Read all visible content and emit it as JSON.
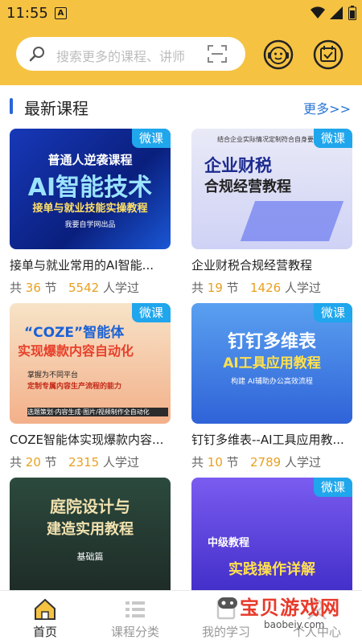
{
  "status": {
    "time": "11:55",
    "notif": "A"
  },
  "search": {
    "placeholder": "搜索更多的课程、讲师"
  },
  "section": {
    "title": "最新课程",
    "more": "更多>>"
  },
  "courses": [
    {
      "tag": "微课",
      "title": "接单与就业常用的AI智能...",
      "count_pre": "共",
      "lessons": "36",
      "count_suf": "节",
      "learners": "5542",
      "learn_suf": "人学过",
      "art": {
        "l1": "普通人逆袭课程",
        "l2": "AI智能技术",
        "l3": "接单与就业技能实操教程",
        "l4": "我要自学网出品"
      }
    },
    {
      "tag": "微课",
      "title": "企业财税合规经营教程",
      "count_pre": "共",
      "lessons": "19",
      "count_suf": "节",
      "learners": "1426",
      "learn_suf": "人学过",
      "art": {
        "l0": "结合企业实际情况定制符合自身要求和",
        "l1": "企业财税",
        "l2": "合规经营教程"
      }
    },
    {
      "tag": "微课",
      "title": "COZE智能体实现爆款内容...",
      "count_pre": "共",
      "lessons": "20",
      "count_suf": "节",
      "learners": "2315",
      "learn_suf": "人学过",
      "art": {
        "l1": "“COZE”智能体",
        "l2": "实现爆款内容自动化",
        "l3": "掌握为不同平台",
        "l4": "定制专属内容生产流程的能力",
        "l5": "选题策划·内容生成·图片/视频制作全自动化"
      }
    },
    {
      "tag": "微课",
      "title": "钉钉多维表--AI工具应用教...",
      "count_pre": "共",
      "lessons": "10",
      "count_suf": "节",
      "learners": "2789",
      "learn_suf": "人学过",
      "art": {
        "l1": "钉钉多维表",
        "l2": "AI工具应用教程",
        "l3": "构建 AI辅助办公高效流程"
      }
    },
    {
      "tag": "",
      "title": "",
      "art": {
        "l1": "庭院设计与",
        "l2": "建造实用教程",
        "l3": "基础篇"
      }
    },
    {
      "tag": "微课",
      "title": "",
      "art": {
        "l1": "中级教程",
        "l2": "实践操作详解"
      }
    }
  ],
  "tabs": [
    {
      "label": "首页"
    },
    {
      "label": "课程分类"
    },
    {
      "label": "我的学习"
    },
    {
      "label": "个人中心"
    }
  ],
  "watermark": {
    "big": "宝贝游戏网",
    "small": "baobeiy.com"
  },
  "colors": {
    "header": "#f5c242",
    "accent": "#2b66d9",
    "tag": "#20a6ec",
    "number": "#e8a020"
  }
}
